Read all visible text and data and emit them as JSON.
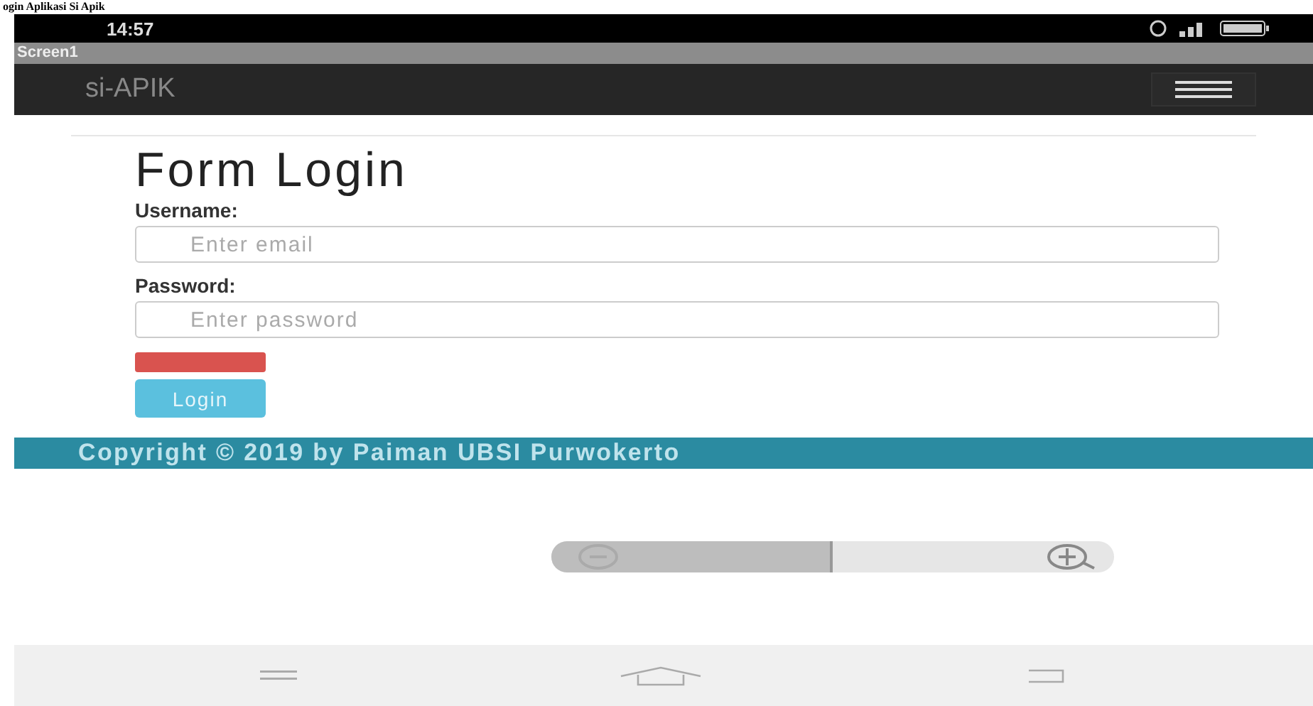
{
  "caption": "ogin Aplikasi Si Apik",
  "status_bar": {
    "time": "14:57"
  },
  "window": {
    "title": "Screen1"
  },
  "app_bar": {
    "brand": "si-APIK"
  },
  "form": {
    "title": "Form Login",
    "fields": [
      {
        "label": "Username:",
        "placeholder": "Enter email"
      },
      {
        "label": "Password:",
        "placeholder": "Enter password"
      }
    ],
    "login_button": "Login"
  },
  "footer": {
    "text": "Copyright © 2019 by Paiman UBSI Purwokerto"
  },
  "zoom": {
    "level": 0.5
  }
}
